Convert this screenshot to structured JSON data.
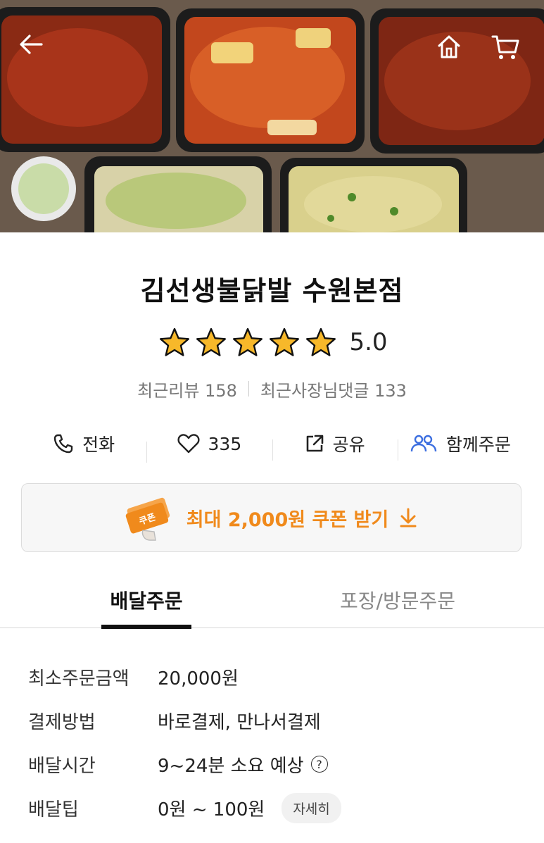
{
  "header": {
    "back_icon": "arrow-left-icon",
    "home_icon": "home-icon",
    "cart_icon": "cart-icon"
  },
  "store": {
    "name": "김선생불닭발 수원본점",
    "rating": "5.0",
    "stars": 5,
    "recent_reviews": "최근리뷰 158",
    "recent_owner_replies": "최근사장님댓글 133"
  },
  "actions": {
    "call_label": "전화",
    "like_count": "335",
    "share_label": "공유",
    "group_order_label": "함께주문"
  },
  "coupon": {
    "label": "최대 2,000원 쿠폰 받기",
    "icon_text": "쿠폰",
    "accent": "#f08a1c"
  },
  "tabs": {
    "delivery": "배달주문",
    "pickup": "포장/방문주문"
  },
  "info": {
    "min_order_label": "최소주문금액",
    "min_order_value": "20,000원",
    "payment_label": "결제방법",
    "payment_value": "바로결제, 만나서결제",
    "delivery_time_label": "배달시간",
    "delivery_time_value": "9~24분 소요 예상",
    "delivery_tip_label": "배달팁",
    "delivery_tip_value": "0원 ~ 100원",
    "detail_label": "자세히"
  }
}
